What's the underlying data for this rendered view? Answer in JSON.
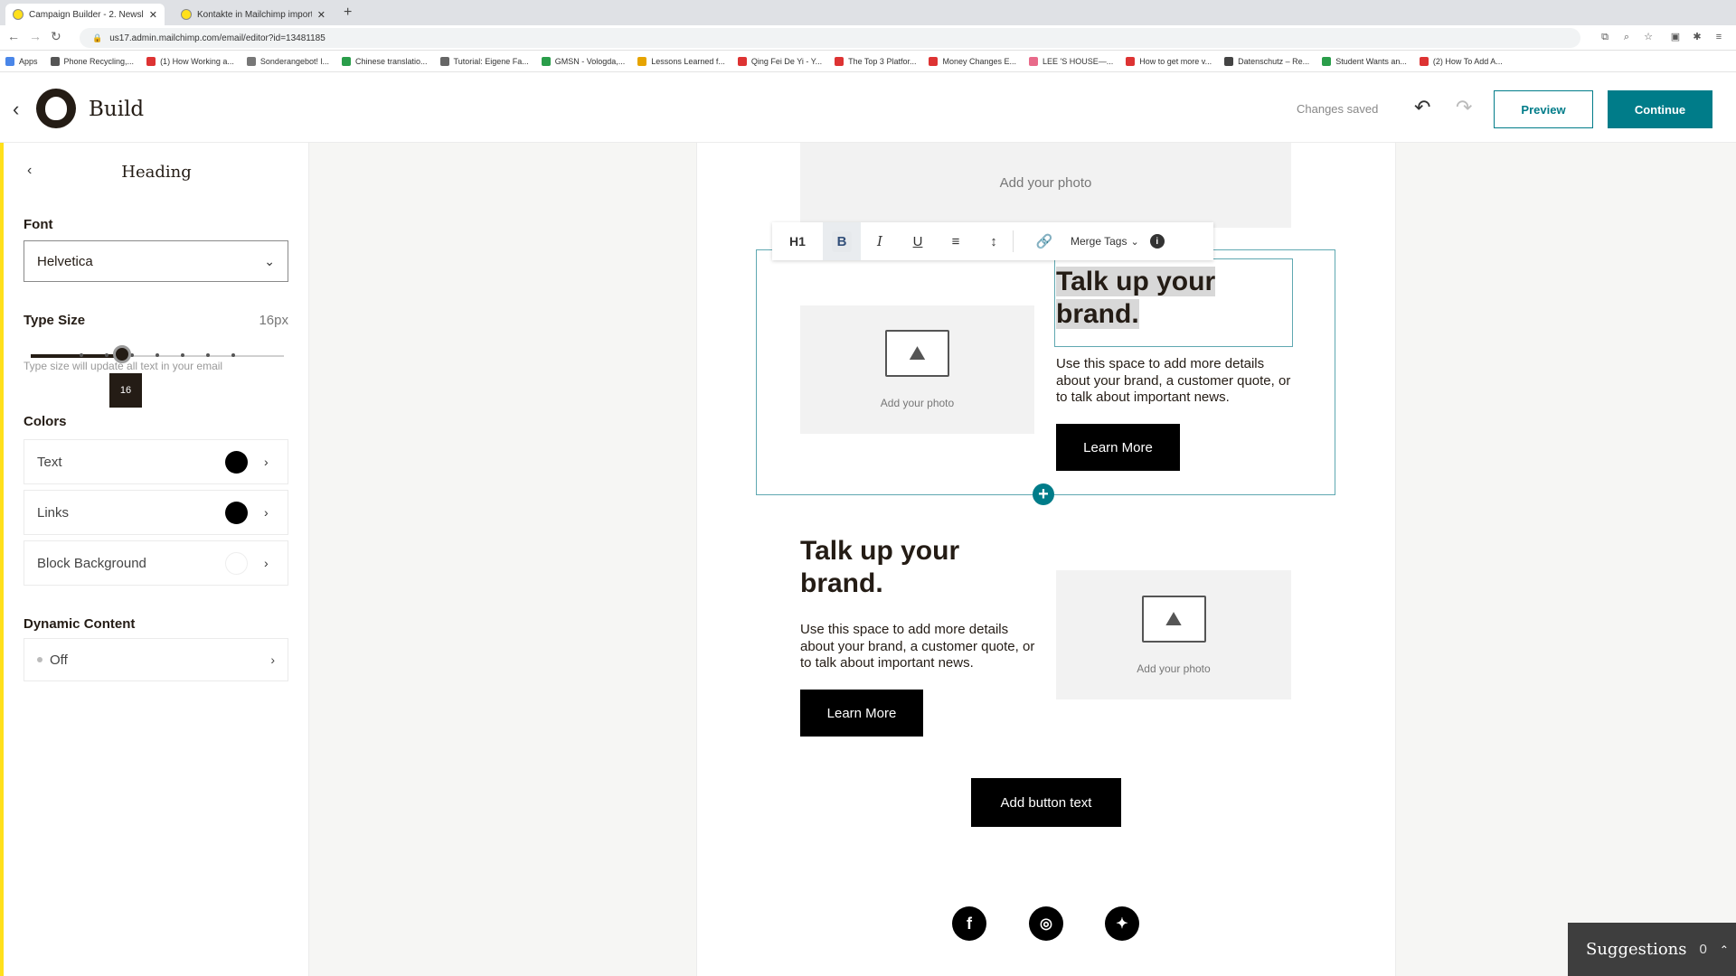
{
  "browser": {
    "tabs": [
      {
        "title": "Campaign Builder - 2. Newsle"
      },
      {
        "title": "Kontakte in Mailchimp importi"
      }
    ],
    "url": "us17.admin.mailchimp.com/email/editor?id=13481185",
    "bookmarks": [
      "Apps",
      "Phone Recycling,...",
      "(1) How Working a...",
      "Sonderangebot! l...",
      "Chinese translatio...",
      "Tutorial: Eigene Fa...",
      "GMSN - Vologda,...",
      "Lessons Learned f...",
      "Qing Fei De Yi - Y...",
      "The Top 3 Platfor...",
      "Money Changes E...",
      "LEE 'S HOUSE—...",
      "How to get more v...",
      "Datenschutz – Re...",
      "Student Wants an...",
      "(2) How To Add A..."
    ]
  },
  "header": {
    "title": "Build",
    "status": "Changes saved",
    "preview_label": "Preview",
    "continue_label": "Continue"
  },
  "sidebar": {
    "title": "Heading",
    "font_label": "Font",
    "font_value": "Helvetica",
    "type_size_label": "Type Size",
    "type_size_value": "16px",
    "slider": {
      "value": 16,
      "min": 10,
      "max": 46,
      "tooltip": "16"
    },
    "type_help": "Type size will update all text in your email",
    "colors_label": "Colors",
    "colors": [
      {
        "label": "Text",
        "color": "#000000"
      },
      {
        "label": "Links",
        "color": "#000000"
      },
      {
        "label": "Block Background",
        "color": "#ffffff"
      }
    ],
    "dynamic_label": "Dynamic Content",
    "dynamic_value": "Off"
  },
  "toolbar": {
    "h1": "H1",
    "bold": "B",
    "italic": "I",
    "underline": "U",
    "merge_tags": "Merge Tags"
  },
  "email": {
    "top_photo": "Add your photo",
    "block1": {
      "heading": "Talk up your brand.",
      "body": "Use this space to add more details about your brand, a customer quote, or to talk about important news.",
      "button": "Learn More",
      "photo": "Add your photo"
    },
    "block2": {
      "heading": "Talk up your brand.",
      "body": "Use this space to add more details about your brand, a customer quote, or to talk about important news.",
      "button": "Learn More",
      "photo": "Add your photo"
    },
    "cta_button": "Add button text",
    "social": [
      "facebook",
      "instagram",
      "twitter"
    ]
  },
  "suggestions": {
    "label": "Suggestions",
    "count": "0"
  },
  "colors": {
    "accent": "#007c89",
    "brand_yellow": "#ffe01b"
  }
}
